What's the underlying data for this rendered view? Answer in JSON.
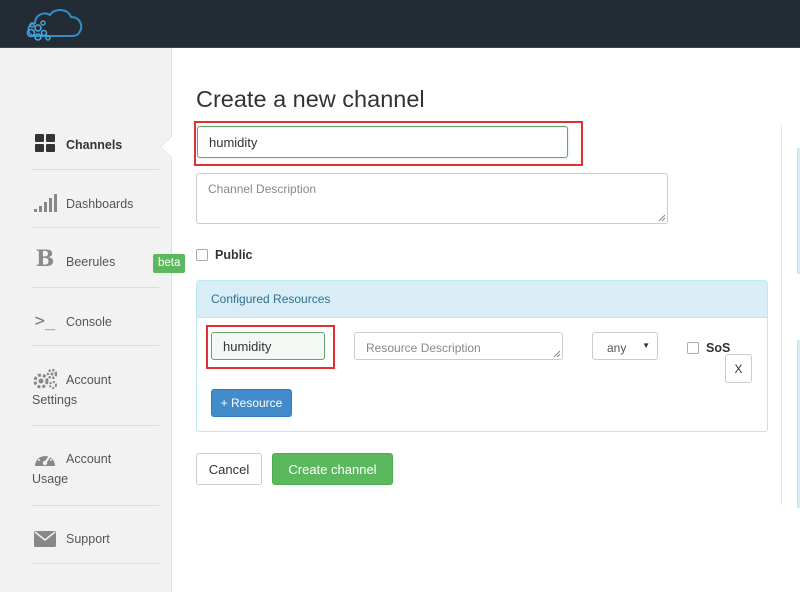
{
  "header": {
    "logo_icon": "cloud-bubbles-logo"
  },
  "sidebar": {
    "items": [
      {
        "label": "Channels",
        "icon": "grid-icon",
        "active": true
      },
      {
        "label": "Dashboards",
        "icon": "bar-signal-icon"
      },
      {
        "label": "Beerules",
        "icon": "beerules-b-icon",
        "badge": "beta"
      },
      {
        "label": "Console",
        "icon": "terminal-icon"
      },
      {
        "label": "Account",
        "label2": "Settings",
        "icon": "gears-icon"
      },
      {
        "label": "Account",
        "label2": "Usage",
        "icon": "gauge-icon"
      },
      {
        "label": "Support",
        "icon": "envelope-icon"
      }
    ]
  },
  "form": {
    "title": "Create a new channel",
    "channel_name_value": "humidity",
    "channel_description_placeholder": "Channel Description",
    "public_label": "Public",
    "resources_panel_title": "Configured Resources",
    "resource": {
      "name_value": "humidity",
      "description_placeholder": "Resource Description",
      "type_selected": "any",
      "sos_label": "SoS",
      "remove_label": "X"
    },
    "add_resource_label": "+ Resource",
    "cancel_label": "Cancel",
    "create_label": "Create channel"
  },
  "colors": {
    "topbar": "#232b34",
    "sidebar_bg": "#f2f2f2",
    "primary": "#428bca",
    "success": "#5cb85c",
    "highlight": "#e03030",
    "panel_header": "#d9edf7"
  }
}
